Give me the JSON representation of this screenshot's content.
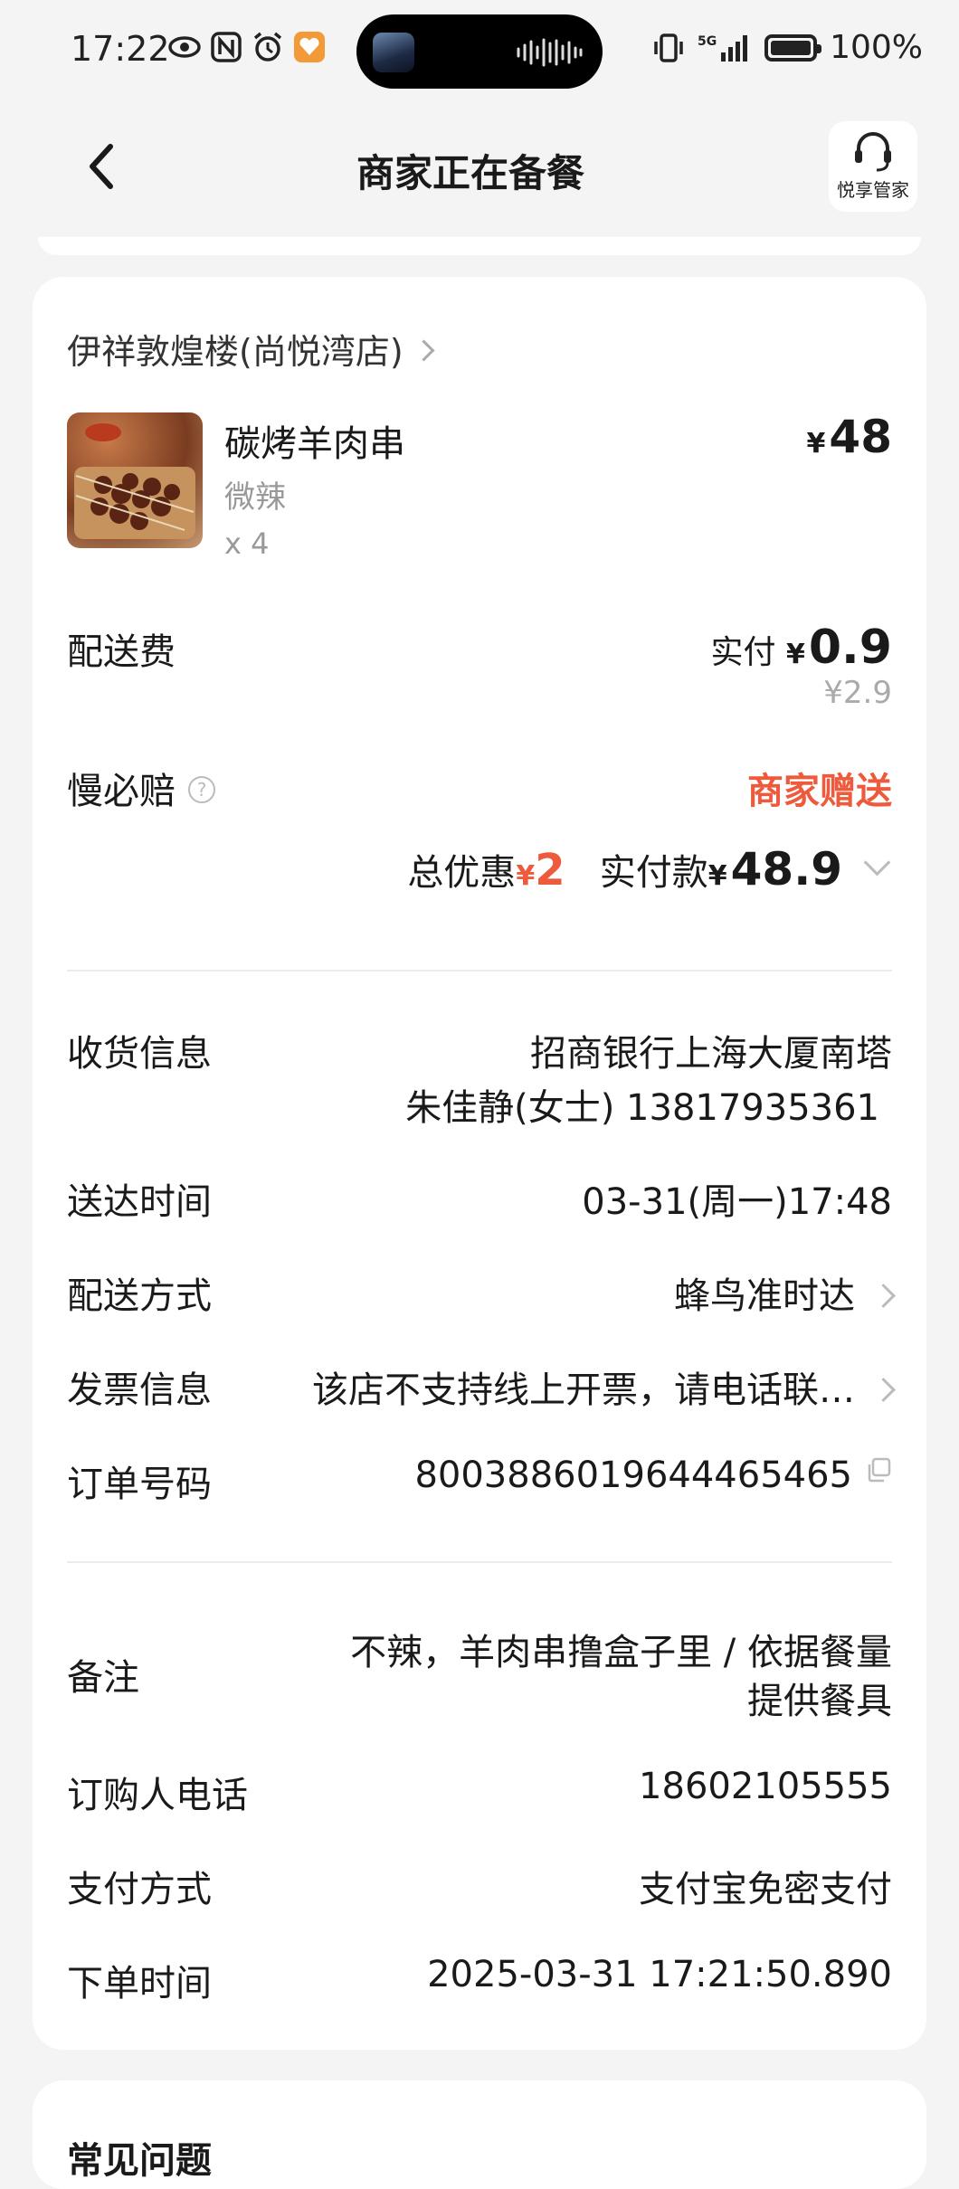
{
  "status_bar": {
    "time": "17:22",
    "battery_pct": "100%",
    "icons": [
      "eye-icon",
      "nfc-icon",
      "alarm-icon",
      "app-badge-icon",
      "vibrate-icon",
      "signal-5g-icon",
      "battery-icon"
    ]
  },
  "nav": {
    "title": "商家正在备餐",
    "helper_label": "悦享管家"
  },
  "order": {
    "shop_name": "伊祥敦煌楼(尚悦湾店)",
    "item": {
      "name": "碳烤羊肉串",
      "spec": "微辣",
      "qty": "x 4",
      "price_symbol": "¥",
      "price": "48"
    },
    "delivery_fee": {
      "label": "配送费",
      "paid_prefix": "实付",
      "paid_symbol": "¥",
      "paid": "0.9",
      "original": "¥2.9"
    },
    "slow_compensation": {
      "label": "慢必赔",
      "value": "商家赠送"
    },
    "totals": {
      "discount_label": "总优惠",
      "discount_symbol": "¥",
      "discount": "2",
      "paid_label": "实付款",
      "paid_symbol": "¥",
      "paid": "48.9"
    }
  },
  "info": {
    "receiver": {
      "label": "收货信息",
      "address": "招商银行上海大厦南塔",
      "contact": "朱佳静(女士) 13817935361"
    },
    "delivery_time": {
      "label": "送达时间",
      "value": "03-31(周一)17:48"
    },
    "delivery_method": {
      "label": "配送方式",
      "value": "蜂鸟准时达"
    },
    "invoice": {
      "label": "发票信息",
      "value": "该店不支持线上开票，请电话联…"
    },
    "order_no": {
      "label": "订单号码",
      "value": "8003886019644465465"
    },
    "remark": {
      "label": "备注",
      "line1": "不辣，羊肉串撸盒子里 / 依据餐量",
      "line2": "提供餐具"
    },
    "buyer_phone": {
      "label": "订购人电话",
      "value": "18602105555"
    },
    "pay_method": {
      "label": "支付方式",
      "value": "支付宝免密支付"
    },
    "order_time": {
      "label": "下单时间",
      "value": "2025-03-31 17:21:50.890"
    }
  },
  "next_section": {
    "title": "常见问题"
  },
  "colors": {
    "accent_red": "#ee5a3c",
    "background": "#f4f4f4",
    "card": "#ffffff"
  }
}
